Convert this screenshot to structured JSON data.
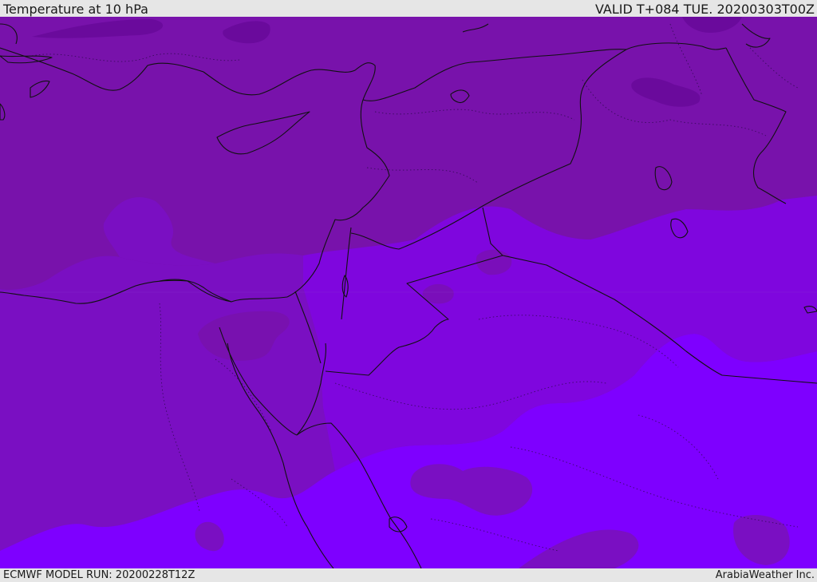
{
  "header": {
    "title": "Temperature at 10 hPa",
    "valid_time": "VALID T+084 TUE. 20200303T00Z"
  },
  "footer": {
    "model_run": "ECMWF MODEL RUN: 20200228T12Z",
    "credit": "ArabiaWeather Inc."
  },
  "map": {
    "variable": "Temperature",
    "level": "10 hPa",
    "colors": {
      "darkest": "#6a0a9c",
      "dark": "#7812ab",
      "mid_dark": "#7a0fc2",
      "mid": "#7f06de",
      "light": "#7e00ff",
      "border": "#111111"
    }
  }
}
